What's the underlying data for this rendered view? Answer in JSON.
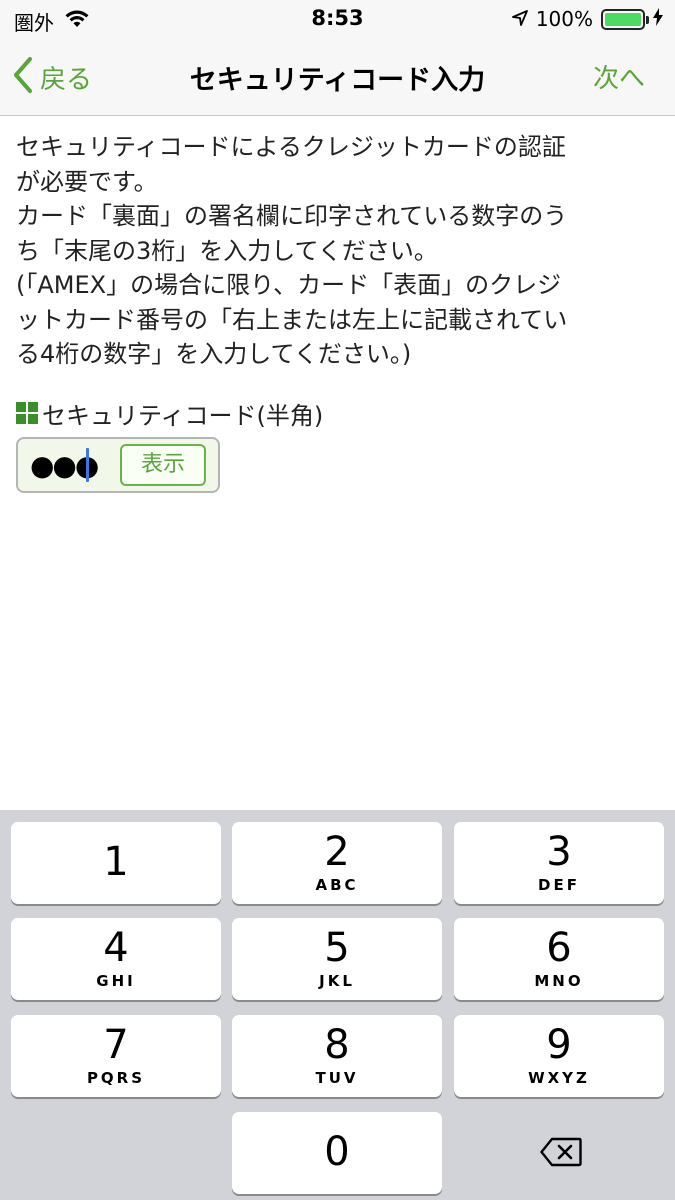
{
  "status_bar": {
    "carrier": "圏外",
    "time": "8:53",
    "battery": "100%",
    "battery_level": 1.0
  },
  "nav": {
    "back_label": "戻る",
    "title": "セキュリティコード入力",
    "next_label": "次へ"
  },
  "content": {
    "description_lines": [
      "セキュリティコードによるクレジットカードの認証",
      "が必要です。",
      "カード「裏面」の署名欄に印字されている数字のう",
      "ち「末尾の3桁」を入力してください。",
      "(「AMEX」の場合に限り、カード「表面」のクレジ",
      "ットカード番号の「右上または左上に記載されてい",
      "る4桁の数字」を入力してください。)"
    ],
    "field_label": "セキュリティコード(半角)",
    "field_value_masked": "●●●",
    "show_button_label": "表示"
  },
  "keyboard": {
    "keys": [
      {
        "num": "1",
        "letters": ""
      },
      {
        "num": "2",
        "letters": "ABC"
      },
      {
        "num": "3",
        "letters": "DEF"
      },
      {
        "num": "4",
        "letters": "GHI"
      },
      {
        "num": "5",
        "letters": "JKL"
      },
      {
        "num": "6",
        "letters": "MNO"
      },
      {
        "num": "7",
        "letters": "PQRS"
      },
      {
        "num": "8",
        "letters": "TUV"
      },
      {
        "num": "9",
        "letters": "WXYZ"
      },
      {
        "num": "0",
        "letters": ""
      }
    ],
    "delete_icon": "backspace-icon"
  },
  "colors": {
    "accent_green": "#5aa53a",
    "input_background": "#f1f8ea",
    "keyboard_background": "#d1d3d9"
  }
}
